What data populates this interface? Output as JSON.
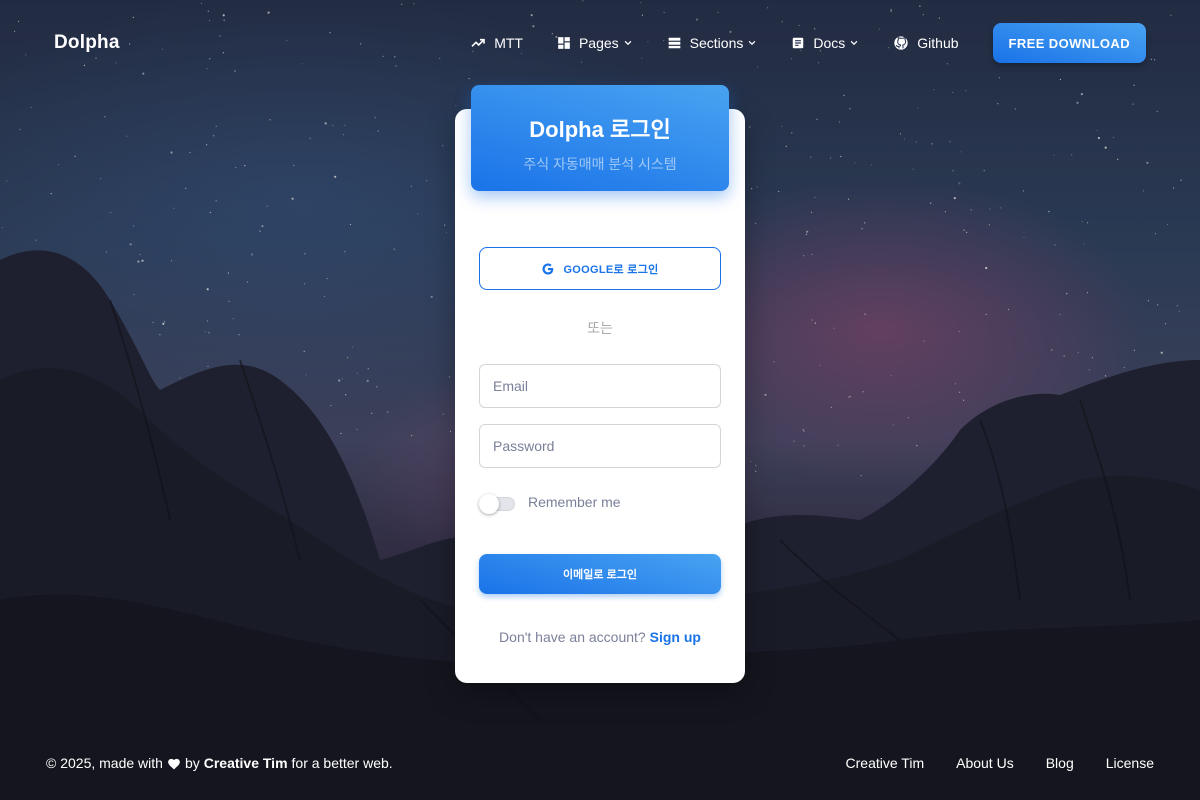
{
  "navbar": {
    "brand": "Dolpha",
    "items": [
      {
        "label": "MTT",
        "icon": "trending-up-icon"
      },
      {
        "label": "Pages",
        "icon": "dashboard-icon"
      },
      {
        "label": "Sections",
        "icon": "view-list-icon"
      },
      {
        "label": "Docs",
        "icon": "article-icon"
      },
      {
        "label": "Github",
        "icon": "github-icon"
      }
    ],
    "download_label": "FREE DOWNLOAD"
  },
  "card": {
    "title": "Dolpha 로그인",
    "subtitle": "주식 자동매매 분석 시스템",
    "google_label": "GOOGLE로 로그인",
    "divider": "또는",
    "email_placeholder": "Email",
    "password_placeholder": "Password",
    "remember_label": "Remember me",
    "remember_checked": false,
    "email_login_label": "이메일로 로그인",
    "signup_prompt": "Don't have an account?",
    "signup_link": "Sign up"
  },
  "footer": {
    "copyright_prefix": "© 2025, made with",
    "by": "by",
    "author": "Creative Tim",
    "suffix": "for a better web.",
    "links": [
      "Creative Tim",
      "About Us",
      "Blog",
      "License"
    ]
  },
  "colors": {
    "accent": "#1a73e8",
    "accent_light": "#49a3f1"
  }
}
